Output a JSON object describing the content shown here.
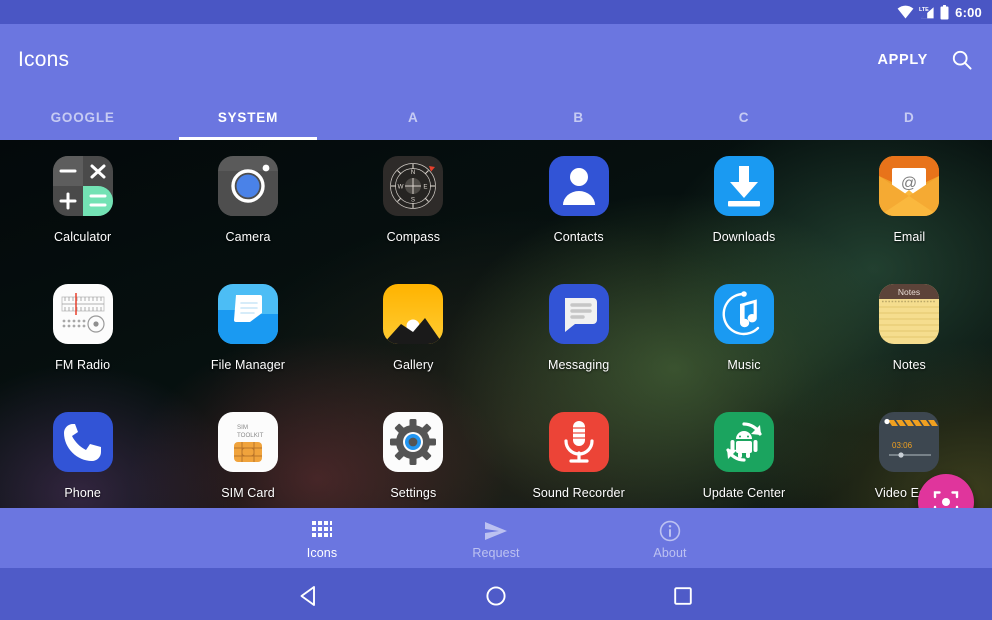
{
  "statusbar": {
    "time": "6:00",
    "icons": [
      "wifi-icon",
      "lte-signal-icon",
      "battery-icon"
    ]
  },
  "appbar": {
    "title": "Icons",
    "apply_label": "APPLY",
    "search_icon": "search-icon"
  },
  "tabs": [
    {
      "label": "GOOGLE",
      "active": false
    },
    {
      "label": "SYSTEM",
      "active": true
    },
    {
      "label": "A",
      "active": false
    },
    {
      "label": "B",
      "active": false
    },
    {
      "label": "C",
      "active": false
    },
    {
      "label": "D",
      "active": false
    }
  ],
  "apps": [
    {
      "label": "Calculator",
      "icon": "calculator-icon"
    },
    {
      "label": "Camera",
      "icon": "camera-icon"
    },
    {
      "label": "Compass",
      "icon": "compass-icon"
    },
    {
      "label": "Contacts",
      "icon": "contacts-icon"
    },
    {
      "label": "Downloads",
      "icon": "downloads-icon"
    },
    {
      "label": "Email",
      "icon": "email-icon"
    },
    {
      "label": "FM Radio",
      "icon": "fm-radio-icon"
    },
    {
      "label": "File Manager",
      "icon": "file-manager-icon"
    },
    {
      "label": "Gallery",
      "icon": "gallery-icon"
    },
    {
      "label": "Messaging",
      "icon": "messaging-icon"
    },
    {
      "label": "Music",
      "icon": "music-icon"
    },
    {
      "label": "Notes",
      "icon": "notes-icon"
    },
    {
      "label": "Phone",
      "icon": "phone-icon"
    },
    {
      "label": "SIM Card",
      "icon": "sim-card-icon"
    },
    {
      "label": "Settings",
      "icon": "settings-icon"
    },
    {
      "label": "Sound Recorder",
      "icon": "sound-recorder-icon"
    },
    {
      "label": "Update Center",
      "icon": "update-center-icon"
    },
    {
      "label": "Video Editor",
      "icon": "video-editor-icon"
    }
  ],
  "icon_art": {
    "sim_card_line1": "SIM",
    "sim_card_line2": "TOOLKIT",
    "notes_header": "Notes",
    "video_editor_time": "03:06"
  },
  "fab": {
    "icon": "preview-focus-icon"
  },
  "bottom_nav": [
    {
      "label": "Icons",
      "icon": "grid-icon",
      "active": true
    },
    {
      "label": "Request",
      "icon": "send-icon",
      "active": false
    },
    {
      "label": "About",
      "icon": "info-icon",
      "active": false
    }
  ],
  "system_nav": [
    {
      "name": "back-button",
      "icon": "triangle-back-icon"
    },
    {
      "name": "home-button",
      "icon": "circle-home-icon"
    },
    {
      "name": "recents-button",
      "icon": "square-recents-icon"
    }
  ],
  "colors": {
    "status_bar": "#4a56c4",
    "app_bar": "#6b76e0",
    "accent_fab": "#e0359c",
    "system_nav": "#4f5bc8"
  }
}
